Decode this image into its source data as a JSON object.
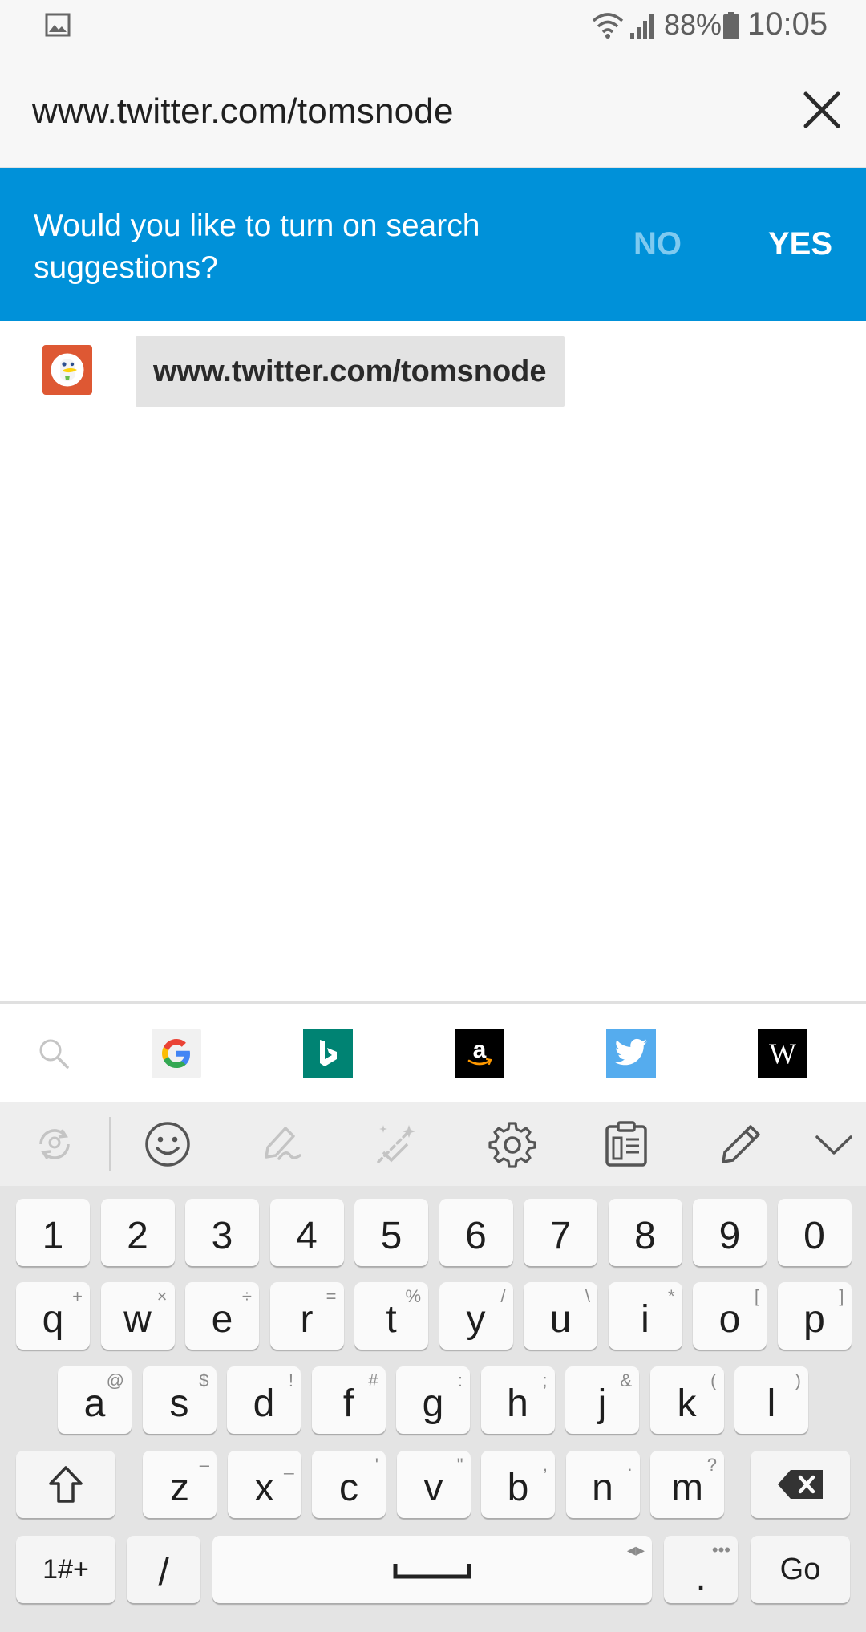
{
  "status_bar": {
    "battery_percent": "88%",
    "time": "10:05",
    "icons": [
      "gallery-icon",
      "wifi-icon",
      "signal-icon",
      "battery-icon"
    ]
  },
  "url_bar": {
    "value": "www.twitter.com/tomsnode",
    "close_icon": "close-icon"
  },
  "banner": {
    "message": "Would you like to turn on search suggestions?",
    "no_label": "NO",
    "yes_label": "YES",
    "background": "#0091d9"
  },
  "suggestion": {
    "text": "www.twitter.com/tomsnode",
    "engine_icon": "duckduckgo-icon"
  },
  "engines": [
    "search-icon",
    "google-icon",
    "bing-icon",
    "amazon-icon",
    "twitter-icon",
    "wikipedia-icon"
  ],
  "wikipedia_glyph": "W",
  "keyboard_toolbar": [
    "sync-icon",
    "emoji-icon",
    "handwriting-icon",
    "magic-pen-icon",
    "settings-icon",
    "clipboard-icon",
    "edit-icon",
    "collapse-icon"
  ],
  "keyboard": {
    "number_row": [
      "1",
      "2",
      "3",
      "4",
      "5",
      "6",
      "7",
      "8",
      "9",
      "0"
    ],
    "row1": [
      {
        "k": "q",
        "s": "+"
      },
      {
        "k": "w",
        "s": "×"
      },
      {
        "k": "e",
        "s": "÷"
      },
      {
        "k": "r",
        "s": "="
      },
      {
        "k": "t",
        "s": "%"
      },
      {
        "k": "y",
        "s": "/"
      },
      {
        "k": "u",
        "s": "\\"
      },
      {
        "k": "i",
        "s": "*"
      },
      {
        "k": "o",
        "s": "["
      },
      {
        "k": "p",
        "s": "]"
      }
    ],
    "row2": [
      {
        "k": "a",
        "s": "@"
      },
      {
        "k": "s",
        "s": "$"
      },
      {
        "k": "d",
        "s": "!"
      },
      {
        "k": "f",
        "s": "#"
      },
      {
        "k": "g",
        "s": ":"
      },
      {
        "k": "h",
        "s": ";"
      },
      {
        "k": "j",
        "s": "&"
      },
      {
        "k": "k",
        "s": "("
      },
      {
        "k": "l",
        "s": ")"
      }
    ],
    "row3": [
      {
        "k": "z",
        "s": "–"
      },
      {
        "k": "x",
        "s": "_"
      },
      {
        "k": "c",
        "s": "'"
      },
      {
        "k": "v",
        "s": "\""
      },
      {
        "k": "b",
        "s": ","
      },
      {
        "k": "n",
        "s": "."
      },
      {
        "k": "m",
        "s": "?"
      }
    ],
    "symbols_label": "1#+",
    "slash_label": "/",
    "dot_label": ".",
    "dot_sup": "•••",
    "go_label": "Go",
    "space_hint": "◂▸"
  },
  "colors": {
    "accent": "#0091d9",
    "duckduckgo": "#de5833",
    "bing": "#008373",
    "twitter": "#55acee"
  }
}
